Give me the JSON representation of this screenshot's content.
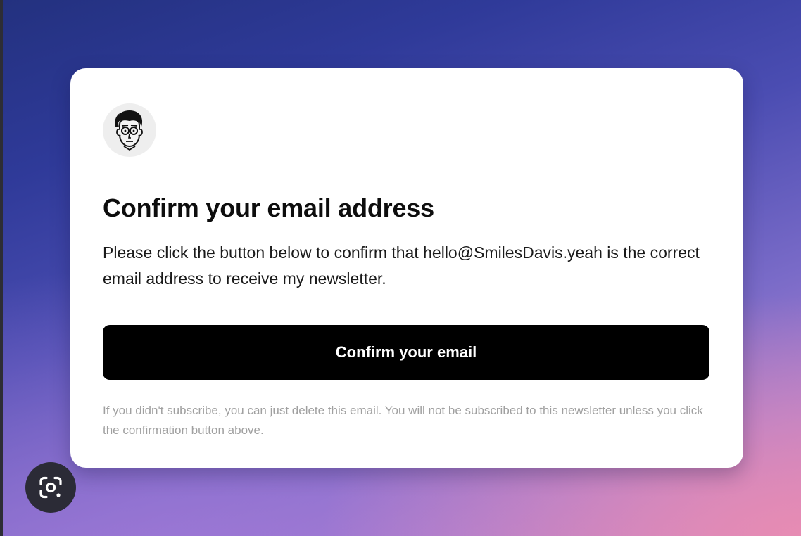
{
  "email_card": {
    "avatar_icon": "cartoon-face-icon",
    "title": "Confirm your email address",
    "body": "Please click the button below to confirm that hello@SmilesDavis.yeah is the correct email address to receive my newsletter.",
    "button_label": "Confirm your email",
    "footnote": "If you didn't subscribe, you can just delete this email. You will not be subscribed to this newsletter unless you click the confirmation button above."
  },
  "overlay": {
    "lens_icon": "lens-search-icon"
  },
  "colors": {
    "button": "#000000",
    "card": "#ffffff",
    "background_top": "#23317f",
    "background_bottom": "#cf86c4"
  }
}
